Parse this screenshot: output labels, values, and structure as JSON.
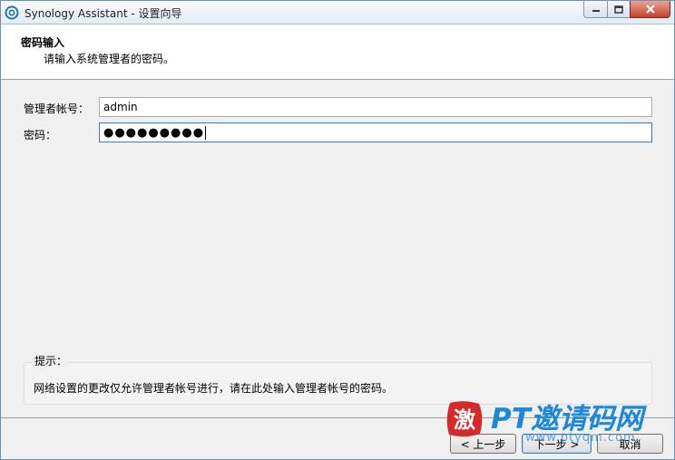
{
  "window": {
    "title": "Synology Assistant - 设置向导",
    "controls": {
      "minimize": "minimize",
      "maximize": "maximize",
      "close": "close"
    }
  },
  "header": {
    "title": "密码输入",
    "subtitle": "请输入系统管理者的密码。"
  },
  "form": {
    "account_label": "管理者帐号：",
    "account_value": "admin",
    "password_label": "密码：",
    "password_mask": "●●●●●●●●●"
  },
  "hint": {
    "title": "提示：",
    "text": "网络设置的更改仅允许管理者帐号进行，请在此处输入管理者帐号的密码。"
  },
  "buttons": {
    "back": "< 上一步",
    "next": "下一步 >",
    "cancel": "取消"
  },
  "watermark": {
    "seal_char": "激",
    "text": "PT邀请码网",
    "url": "www.ptyqm.com"
  },
  "colors": {
    "accent": "#3d7bad",
    "watermark_blue": "#1e88d8",
    "seal_red": "#d62a2a",
    "close_red": "#c5422d"
  }
}
